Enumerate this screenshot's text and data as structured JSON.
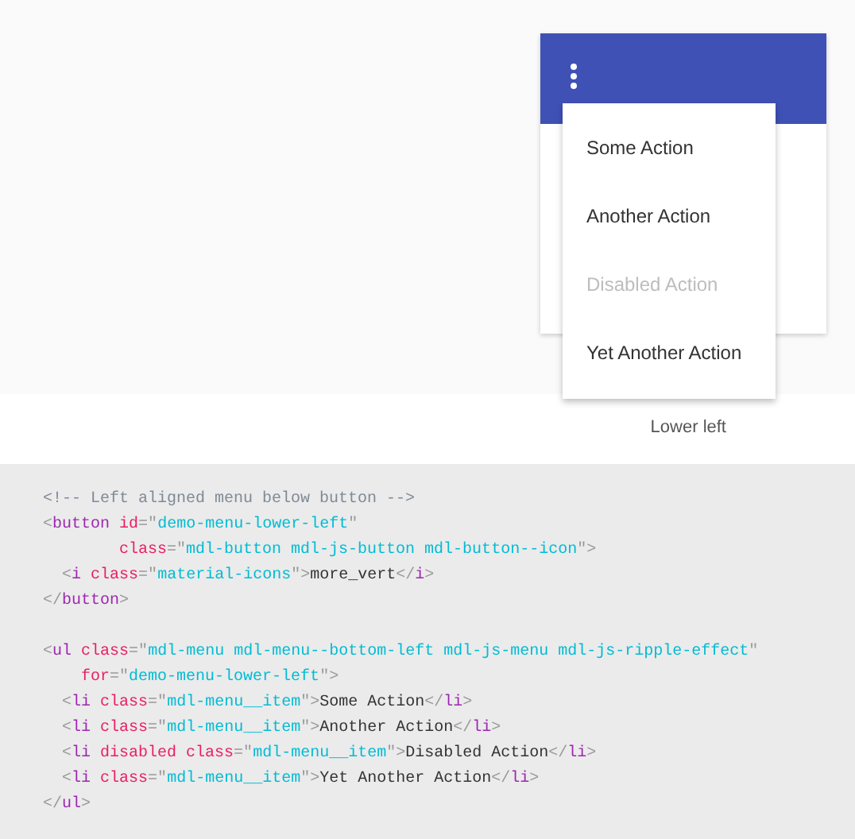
{
  "demo": {
    "menu_items": [
      {
        "label": "Some Action",
        "disabled": false
      },
      {
        "label": "Another Action",
        "disabled": false
      },
      {
        "label": "Disabled Action",
        "disabled": true
      },
      {
        "label": "Yet Another Action",
        "disabled": false
      }
    ],
    "caption": "Lower left"
  },
  "code_blocks": [
    [
      [
        {
          "kind": "comment",
          "text": "<!-- Left aligned menu below button -->"
        }
      ],
      [
        {
          "kind": "punct",
          "text": "<"
        },
        {
          "kind": "tag",
          "text": "button"
        },
        {
          "kind": "attr",
          "text": " id"
        },
        {
          "kind": "punct",
          "text": "=\""
        },
        {
          "kind": "string",
          "text": "demo-menu-lower-left"
        },
        {
          "kind": "punct",
          "text": "\""
        }
      ],
      [
        {
          "kind": "attr",
          "text": "        class"
        },
        {
          "kind": "punct",
          "text": "=\""
        },
        {
          "kind": "string",
          "text": "mdl-button mdl-js-button mdl-button--icon"
        },
        {
          "kind": "punct",
          "text": "\">"
        }
      ],
      [
        {
          "kind": "punct",
          "text": "  <"
        },
        {
          "kind": "tag",
          "text": "i"
        },
        {
          "kind": "attr",
          "text": " class"
        },
        {
          "kind": "punct",
          "text": "=\""
        },
        {
          "kind": "string",
          "text": "material-icons"
        },
        {
          "kind": "punct",
          "text": "\">"
        },
        {
          "kind": "plain",
          "text": "more_vert"
        },
        {
          "kind": "punct",
          "text": "</"
        },
        {
          "kind": "tag",
          "text": "i"
        },
        {
          "kind": "punct",
          "text": ">"
        }
      ],
      [
        {
          "kind": "punct",
          "text": "</"
        },
        {
          "kind": "tag",
          "text": "button"
        },
        {
          "kind": "punct",
          "text": ">"
        }
      ]
    ],
    [
      [
        {
          "kind": "punct",
          "text": "<"
        },
        {
          "kind": "tag",
          "text": "ul"
        },
        {
          "kind": "attr",
          "text": " class"
        },
        {
          "kind": "punct",
          "text": "=\""
        },
        {
          "kind": "string",
          "text": "mdl-menu mdl-menu--bottom-left mdl-js-menu mdl-js-ripple-effect"
        },
        {
          "kind": "punct",
          "text": "\""
        }
      ],
      [
        {
          "kind": "attr",
          "text": "    for"
        },
        {
          "kind": "punct",
          "text": "=\""
        },
        {
          "kind": "string",
          "text": "demo-menu-lower-left"
        },
        {
          "kind": "punct",
          "text": "\">"
        }
      ],
      [
        {
          "kind": "punct",
          "text": "  <"
        },
        {
          "kind": "tag",
          "text": "li"
        },
        {
          "kind": "attr",
          "text": " class"
        },
        {
          "kind": "punct",
          "text": "=\""
        },
        {
          "kind": "string",
          "text": "mdl-menu__item"
        },
        {
          "kind": "punct",
          "text": "\">"
        },
        {
          "kind": "plain",
          "text": "Some Action"
        },
        {
          "kind": "punct",
          "text": "</"
        },
        {
          "kind": "tag",
          "text": "li"
        },
        {
          "kind": "punct",
          "text": ">"
        }
      ],
      [
        {
          "kind": "punct",
          "text": "  <"
        },
        {
          "kind": "tag",
          "text": "li"
        },
        {
          "kind": "attr",
          "text": " class"
        },
        {
          "kind": "punct",
          "text": "=\""
        },
        {
          "kind": "string",
          "text": "mdl-menu__item"
        },
        {
          "kind": "punct",
          "text": "\">"
        },
        {
          "kind": "plain",
          "text": "Another Action"
        },
        {
          "kind": "punct",
          "text": "</"
        },
        {
          "kind": "tag",
          "text": "li"
        },
        {
          "kind": "punct",
          "text": ">"
        }
      ],
      [
        {
          "kind": "punct",
          "text": "  <"
        },
        {
          "kind": "tag",
          "text": "li"
        },
        {
          "kind": "attr",
          "text": " disabled class"
        },
        {
          "kind": "punct",
          "text": "=\""
        },
        {
          "kind": "string",
          "text": "mdl-menu__item"
        },
        {
          "kind": "punct",
          "text": "\">"
        },
        {
          "kind": "plain",
          "text": "Disabled Action"
        },
        {
          "kind": "punct",
          "text": "</"
        },
        {
          "kind": "tag",
          "text": "li"
        },
        {
          "kind": "punct",
          "text": ">"
        }
      ],
      [
        {
          "kind": "punct",
          "text": "  <"
        },
        {
          "kind": "tag",
          "text": "li"
        },
        {
          "kind": "attr",
          "text": " class"
        },
        {
          "kind": "punct",
          "text": "=\""
        },
        {
          "kind": "string",
          "text": "mdl-menu__item"
        },
        {
          "kind": "punct",
          "text": "\">"
        },
        {
          "kind": "plain",
          "text": "Yet Another Action"
        },
        {
          "kind": "punct",
          "text": "</"
        },
        {
          "kind": "tag",
          "text": "li"
        },
        {
          "kind": "punct",
          "text": ">"
        }
      ],
      [
        {
          "kind": "punct",
          "text": "</"
        },
        {
          "kind": "tag",
          "text": "ul"
        },
        {
          "kind": "punct",
          "text": ">"
        }
      ]
    ]
  ]
}
